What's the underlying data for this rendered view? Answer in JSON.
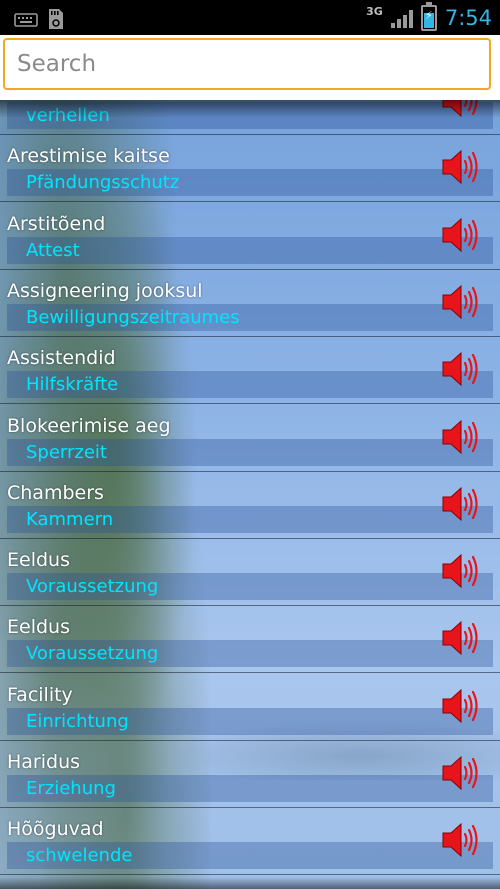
{
  "status_bar": {
    "network": "3G",
    "time": "7:54",
    "left_icons": [
      "keyboard-icon",
      "sd-card-icon"
    ]
  },
  "search": {
    "placeholder": "Search",
    "value": ""
  },
  "colors": {
    "accent": "#f5a623",
    "translation_text": "#00e5ff",
    "speaker_icon": "#e8141c",
    "clock": "#33b5e5"
  },
  "entries": [
    {
      "term": "",
      "translation": "verhellen"
    },
    {
      "term": "Arestimise kaitse",
      "translation": "Pfändungsschutz"
    },
    {
      "term": "Arstitõend",
      "translation": "Attest"
    },
    {
      "term": "Assigneering jooksul",
      "translation": "Bewilligungszeitraumes"
    },
    {
      "term": "Assistendid",
      "translation": "Hilfskräfte"
    },
    {
      "term": "Blokeerimise aeg",
      "translation": "Sperrzeit"
    },
    {
      "term": "Chambers",
      "translation": "Kammern"
    },
    {
      "term": "Eeldus",
      "translation": "Voraussetzung"
    },
    {
      "term": "Eeldus",
      "translation": "Voraussetzung"
    },
    {
      "term": "Facility",
      "translation": "Einrichtung"
    },
    {
      "term": "Haridus",
      "translation": "Erziehung"
    },
    {
      "term": "Hõõguvad",
      "translation": "schwelende"
    }
  ]
}
